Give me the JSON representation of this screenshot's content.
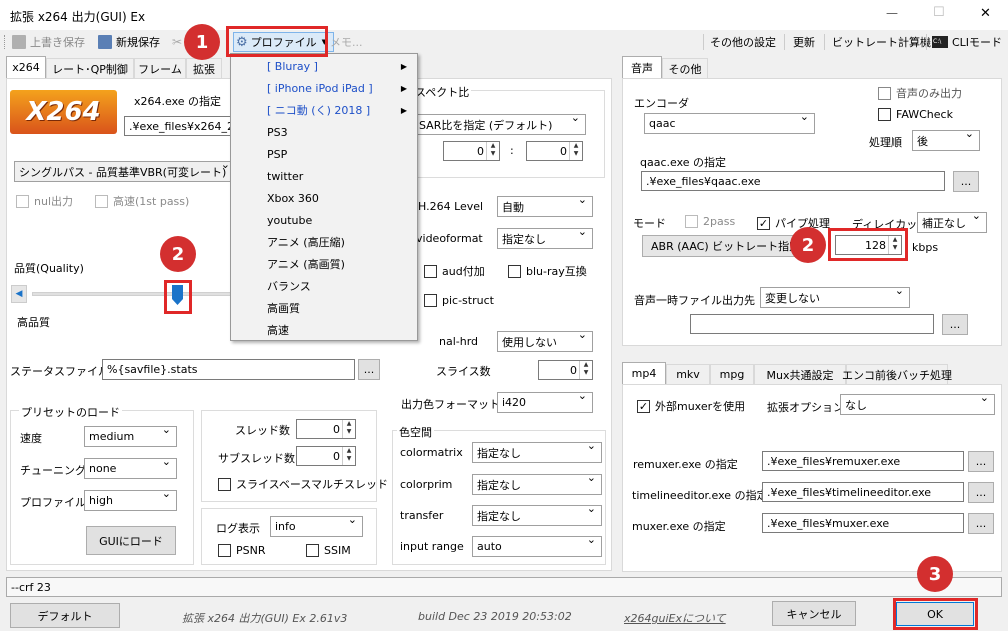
{
  "window": {
    "title": "拡張 x264 出力(GUI) Ex",
    "min": "—",
    "max": "☐",
    "close": "✕"
  },
  "toolbar": {
    "overwrite": "上書き保存",
    "new_save": "新規保存",
    "profile": "プロファイル",
    "memo": "メモ...",
    "other_settings": "その他の設定",
    "update": "更新",
    "bitrate_calc": "ビットレート計算機",
    "cli_mode": "CLIモード"
  },
  "profile_menu": {
    "items": [
      "[ Bluray ]",
      "[ iPhone iPod iPad ]",
      "[ ニコ動 (く) 2018 ]",
      "PS3",
      "PSP",
      "twitter",
      "Xbox 360",
      "youtube",
      "アニメ (高圧縮)",
      "アニメ (高画質)",
      "バランス",
      "高画質",
      "高速"
    ]
  },
  "left_tabs": [
    "x264",
    "レート･QP制御",
    "フレーム",
    "拡張"
  ],
  "x264": {
    "logo": "X264",
    "exe_label": "x264.exe の指定",
    "exe_path": ".¥exe_files¥x264_2",
    "mode": "シングルパス - 品質基準VBR(可変レート)",
    "nul_out": "nul出力",
    "fast_1st": "高速(1st pass)",
    "quality_label": "品質(Quality)",
    "high_quality": "高品質",
    "quality_value": 0.55,
    "status_label": "ステータスファイル",
    "status_value": "%{savfile}.stats",
    "browse": "...",
    "preset_group": "プリセットのロード",
    "speed_label": "速度",
    "speed_value": "medium",
    "tune_label": "チューニング",
    "tune_value": "none",
    "profile_label": "プロファイル",
    "profile_value": "high",
    "gui_load": "GUIにロード",
    "threads_label": "スレッド数",
    "threads_value": "0",
    "subthreads_label": "サブスレッド数",
    "subthreads_value": "0",
    "slice_multi": "スライスベースマルチスレッド",
    "log_label": "ログ表示",
    "log_value": "info",
    "psnr": "PSNR",
    "ssim": "SSIM"
  },
  "x264_right": {
    "aspect_group": "スペクト比",
    "sar_value": "SAR比を指定 (デフォルト)",
    "sar_x": "0",
    "sar_sep": ":",
    "sar_y": "0",
    "h264_label": "H.264 Level",
    "h264_value": "自動",
    "videoformat_label": "videoformat",
    "videoformat_value": "指定なし",
    "aud": "aud付加",
    "bluray": "blu-ray互換",
    "picstruct": "pic-struct",
    "nalhrd_label": "nal-hrd",
    "nalhrd_value": "使用しない",
    "slices_label": "スライス数",
    "slices_value": "0",
    "outcolor_label": "出力色フォーマット",
    "outcolor_value": "i420",
    "colorspace_group": "色空間",
    "colormatrix_label": "colormatrix",
    "colormatrix_value": "指定なし",
    "colorprim_label": "colorprim",
    "colorprim_value": "指定なし",
    "transfer_label": "transfer",
    "transfer_value": "指定なし",
    "inputrange_label": "input range",
    "inputrange_value": "auto"
  },
  "audio_tabs": [
    "音声",
    "その他"
  ],
  "audio": {
    "encoder_label": "エンコーダ",
    "encoder_value": "qaac",
    "audio_only": "音声のみ出力",
    "fawcheck": "FAWCheck",
    "order_label": "処理順",
    "order_value": "後",
    "exe_label": "qaac.exe の指定",
    "exe_path": ".¥exe_files¥qaac.exe",
    "mode_label": "モード",
    "twopass": "2pass",
    "pipe": "パイプ処理",
    "delay_label": "ディレイカット",
    "delay_value": "補正なし",
    "mode_value": "ABR (AAC) ビットレート指定",
    "bitrate_value": "128",
    "kbps": "kbps",
    "temp_label": "音声一時ファイル出力先",
    "temp_value": "変更しない",
    "temp_path": ""
  },
  "mux_tabs": [
    "mp4",
    "mkv",
    "mpg",
    "Mux共通設定",
    "エンコ前後バッチ処理"
  ],
  "mux": {
    "external": "外部muxerを使用",
    "ext_opt_label": "拡張オプション",
    "ext_opt_value": "なし",
    "remuxer_label": "remuxer.exe の指定",
    "remuxer_path": ".¥exe_files¥remuxer.exe",
    "timeline_label": "timelineeditor.exe の指定",
    "timeline_path": ".¥exe_files¥timelineeditor.exe",
    "muxer_label": "muxer.exe の指定",
    "muxer_path": ".¥exe_files¥muxer.exe"
  },
  "cmdline": "--crf 23",
  "bottom": {
    "default_btn": "デフォルト",
    "version": "拡張 x264 出力(GUI) Ex 2.61v3",
    "build": "build Dec 23 2019 20:53:02",
    "about": "x264guiExについて",
    "cancel": "キャンセル",
    "ok": "OK"
  },
  "badges": {
    "b1": "1",
    "b2a": "2",
    "b2b": "2",
    "b3": "3"
  },
  "colors": {
    "accent": "#e02828",
    "badge": "#d32f2f",
    "link": "#1e50c8"
  }
}
